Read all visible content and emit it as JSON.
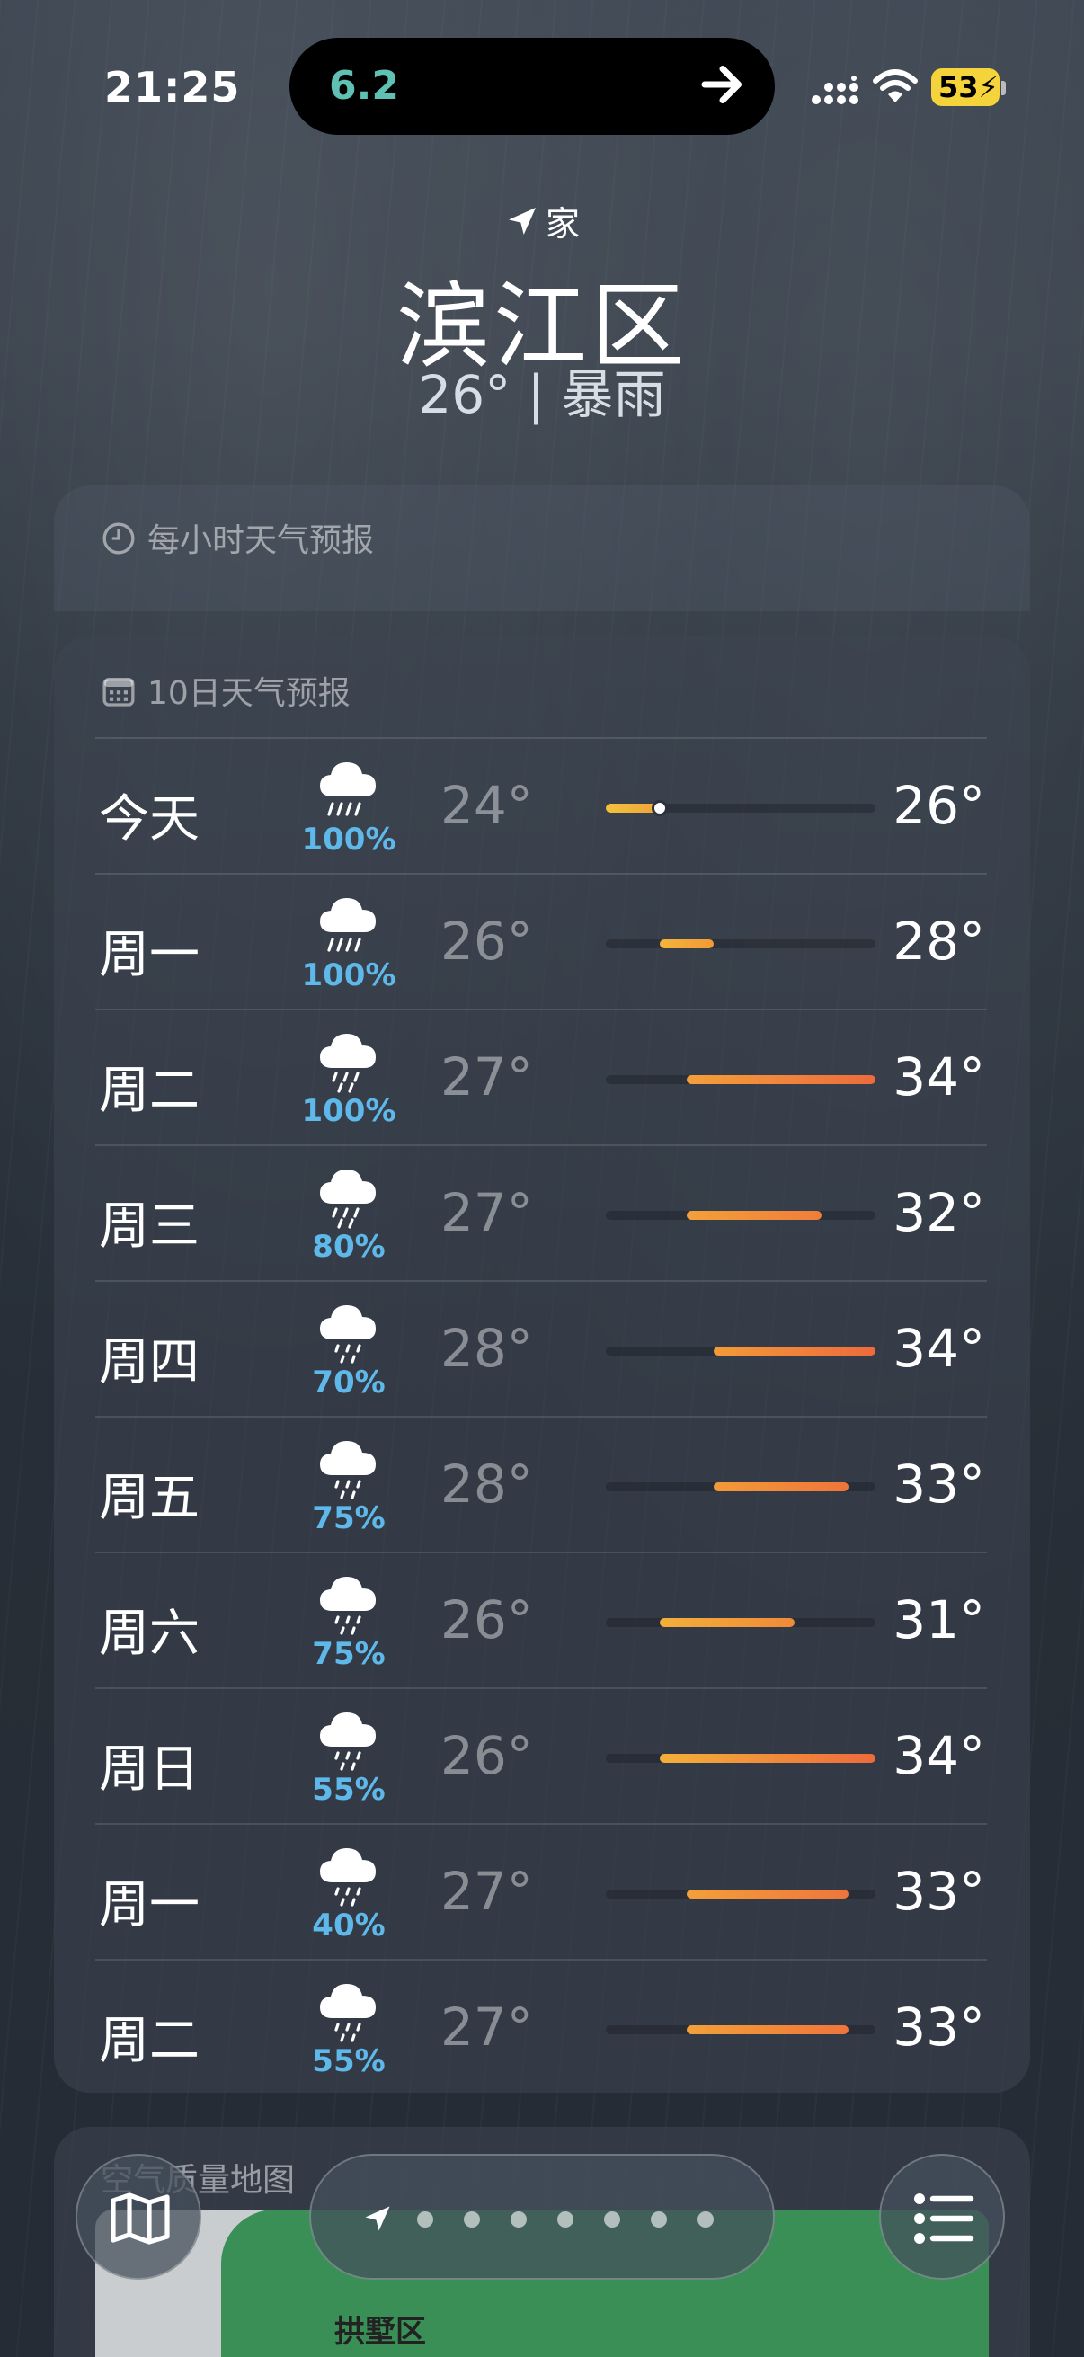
{
  "status_bar": {
    "time": "21:25",
    "island_value": "6.2",
    "battery": "53"
  },
  "header": {
    "location_tag": "家",
    "city": "滨江区",
    "summary": "26° | 暴雨"
  },
  "hourly": {
    "label": "每小时天气预报"
  },
  "forecast": {
    "label": "10日天气预报",
    "range_min": 24,
    "range_max": 34,
    "days": [
      {
        "day": "今天",
        "icon": "heavy-rain-icon",
        "precip": "100%",
        "low": "24°",
        "high": "26°",
        "low_v": 24,
        "high_v": 26,
        "current_v": 26,
        "color_a": "#f2c23c",
        "color_b": "#f0a33a"
      },
      {
        "day": "周一",
        "icon": "heavy-rain-icon",
        "precip": "100%",
        "low": "26°",
        "high": "28°",
        "low_v": 26,
        "high_v": 28,
        "color_a": "#f3b53a",
        "color_b": "#f29a36"
      },
      {
        "day": "周二",
        "icon": "rain-icon",
        "precip": "100%",
        "low": "27°",
        "high": "34°",
        "low_v": 27,
        "high_v": 34,
        "color_a": "#f3a03a",
        "color_b": "#ee6a3c"
      },
      {
        "day": "周三",
        "icon": "rain-icon",
        "precip": "80%",
        "low": "27°",
        "high": "32°",
        "low_v": 27,
        "high_v": 32,
        "color_a": "#f3a03a",
        "color_b": "#f07d3a"
      },
      {
        "day": "周四",
        "icon": "light-rain-icon",
        "precip": "70%",
        "low": "28°",
        "high": "34°",
        "low_v": 28,
        "high_v": 34,
        "color_a": "#f29a38",
        "color_b": "#ee6a3c"
      },
      {
        "day": "周五",
        "icon": "light-rain-icon",
        "precip": "75%",
        "low": "28°",
        "high": "33°",
        "low_v": 28,
        "high_v": 33,
        "color_a": "#f29a38",
        "color_b": "#ef753b"
      },
      {
        "day": "周六",
        "icon": "light-rain-icon",
        "precip": "75%",
        "low": "26°",
        "high": "31°",
        "low_v": 26,
        "high_v": 31,
        "color_a": "#f3b03a",
        "color_b": "#f08a38"
      },
      {
        "day": "周日",
        "icon": "light-rain-icon",
        "precip": "55%",
        "low": "26°",
        "high": "34°",
        "low_v": 26,
        "high_v": 34,
        "color_a": "#f3b03a",
        "color_b": "#ee6a3c"
      },
      {
        "day": "周一",
        "icon": "light-rain-icon",
        "precip": "40%",
        "low": "27°",
        "high": "33°",
        "low_v": 27,
        "high_v": 33,
        "color_a": "#f3a03a",
        "color_b": "#ef753b"
      },
      {
        "day": "周二",
        "icon": "light-rain-icon",
        "precip": "55%",
        "low": "27°",
        "high": "33°",
        "low_v": 27,
        "high_v": 33,
        "color_a": "#f3a03a",
        "color_b": "#ef753b"
      }
    ]
  },
  "air_quality": {
    "title": "空气质量地图",
    "place": "拱墅区"
  },
  "toolbar": {
    "page_dots": 7
  }
}
